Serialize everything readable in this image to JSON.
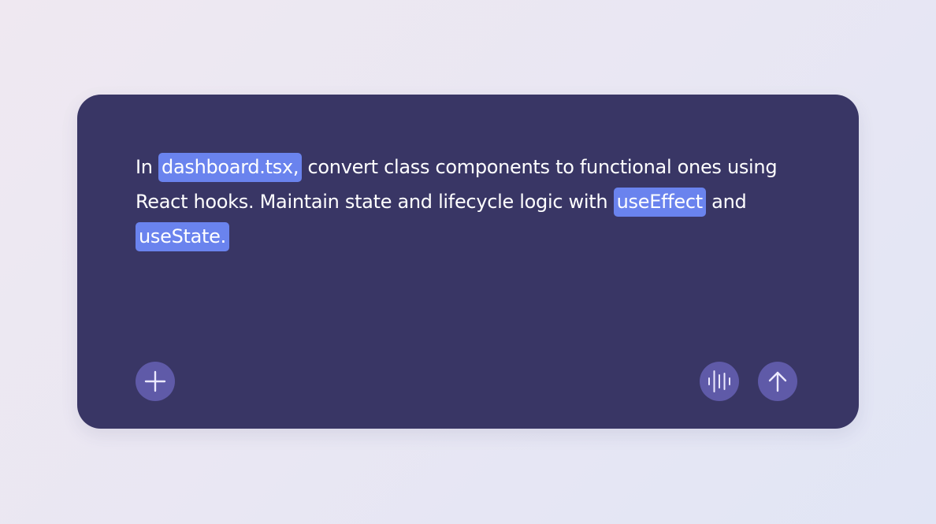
{
  "composer": {
    "prompt_segments": [
      {
        "text": "In ",
        "chip": false
      },
      {
        "text": "dashboard.tsx,",
        "chip": true
      },
      {
        "text": " convert class components to functional ones using React hooks. Maintain state and lifecycle logic with ",
        "chip": false
      },
      {
        "text": "useEffect",
        "chip": true
      },
      {
        "text": " and ",
        "chip": false
      },
      {
        "text": "useState.",
        "chip": true
      }
    ],
    "chip_color": "#6a83ee",
    "buttons": {
      "add": {
        "icon": "plus-icon"
      },
      "voice": {
        "icon": "waveform-icon"
      },
      "send": {
        "icon": "arrow-up-icon"
      }
    }
  },
  "colors": {
    "card_bg": "#393665",
    "button_bg": "#5f5aa8",
    "text": "#ffffff"
  }
}
